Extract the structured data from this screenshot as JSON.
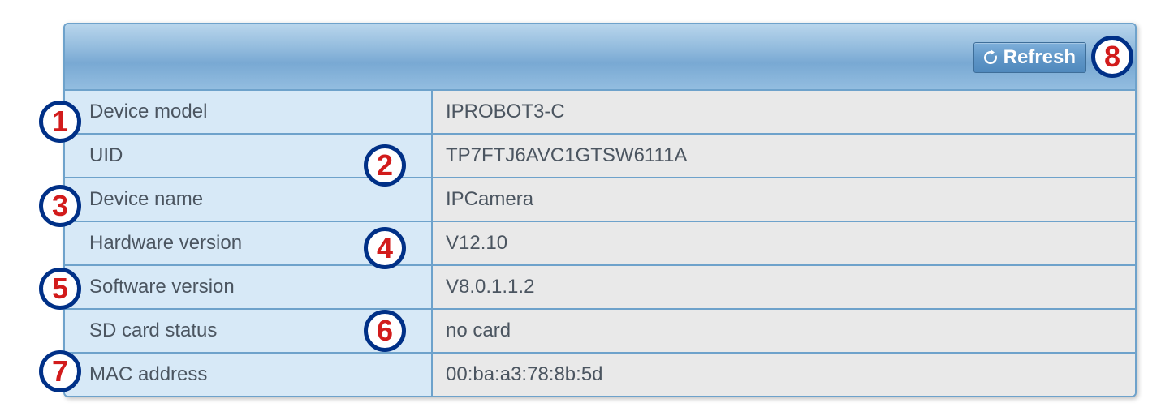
{
  "header": {
    "refresh_label": "Refresh"
  },
  "rows": [
    {
      "label": "Device model",
      "value": "IPROBOT3-C"
    },
    {
      "label": "UID",
      "value": "TP7FTJ6AVC1GTSW6111A"
    },
    {
      "label": "Device name",
      "value": "IPCamera"
    },
    {
      "label": "Hardware version",
      "value": "V12.10"
    },
    {
      "label": "Software version",
      "value": "V8.0.1.1.2"
    },
    {
      "label": "SD card status",
      "value": "no card"
    },
    {
      "label": "MAC address",
      "value": "00:ba:a3:78:8b:5d"
    }
  ],
  "callouts": {
    "c1": "1",
    "c2": "2",
    "c3": "3",
    "c4": "4",
    "c5": "5",
    "c6": "6",
    "c7": "7",
    "c8": "8"
  }
}
